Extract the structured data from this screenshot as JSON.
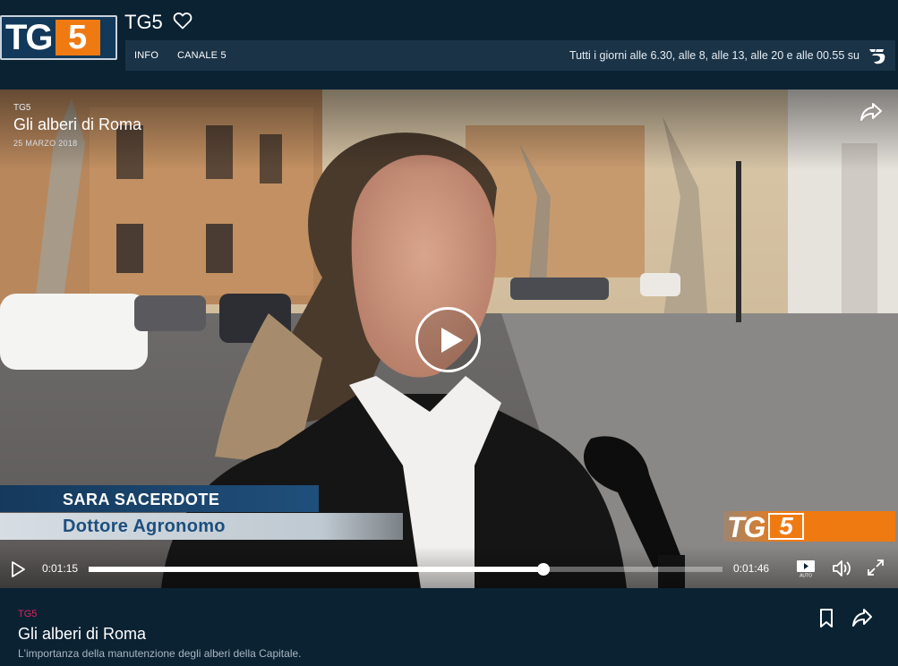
{
  "header": {
    "logo_text": "TG",
    "logo_number": "5",
    "title": "TG5",
    "favorite_icon": "heart-icon",
    "nav": [
      {
        "label": "INFO"
      },
      {
        "label": "CANALE 5"
      }
    ],
    "schedule": "Tutti i giorni alle 6.30, alle 8, alle 13, alle 20 e alle 00.55 su",
    "channel_icon": "canale5-logo-icon"
  },
  "player": {
    "program": "TG5",
    "title": "Gli alberi di Roma",
    "date": "25 MARZO 2018",
    "share_icon": "share-icon",
    "play_icon": "play-icon",
    "lower_third": {
      "name": "SARA SACERDOTE",
      "role": "Dottore Agronomo"
    },
    "bug": {
      "text": "TG",
      "number": "5"
    },
    "controls": {
      "current_time": "0:01:15",
      "duration": "0:01:46",
      "progress": 0.717,
      "autoplay_icon": "autoplay-icon",
      "volume_icon": "volume-icon",
      "fullscreen_icon": "fullscreen-icon"
    }
  },
  "info": {
    "program": "TG5",
    "title": "Gli alberi di Roma",
    "description": "L'importanza della manutenzione degli alberi della Capitale.",
    "bookmark_icon": "bookmark-icon",
    "share_icon": "share-icon"
  },
  "colors": {
    "background": "#0b2233",
    "brand_orange": "#f07a12",
    "accent_pink": "#e0245e",
    "brand_blue": "#12385a"
  }
}
